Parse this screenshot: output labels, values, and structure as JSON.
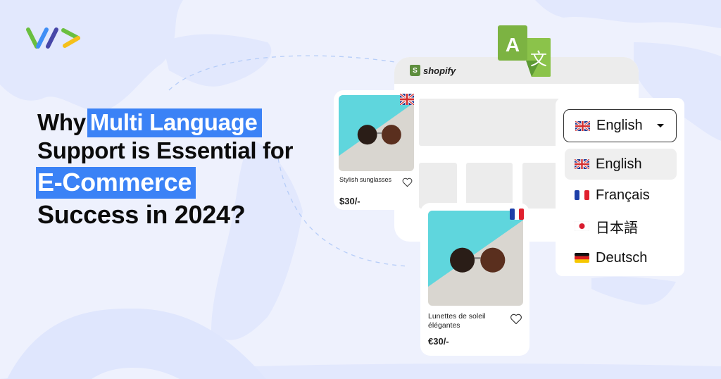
{
  "brand": {
    "logo_icon": "code-chevron-logo"
  },
  "headline": {
    "line1_prefix": "Why",
    "line1_highlight": "Multi Language",
    "line2": "Support is Essential for",
    "line3_highlight": "E-Commerce",
    "line4": "Success in 2024?"
  },
  "colors": {
    "background": "#eef1fd",
    "highlight": "#3b82f6",
    "translate_green": "#7cb342",
    "shopify_green": "#5e8e3e"
  },
  "store_window": {
    "platform_label": "shopify",
    "platform_icon": "shopify-bag-icon",
    "translate_icon": "translate-icon",
    "translate_glyph_a": "A",
    "translate_glyph_b": "文"
  },
  "products": [
    {
      "name": "Stylish sunglasses",
      "price": "$30/-",
      "flag": "uk-flag",
      "locale": "en"
    },
    {
      "name": "Lunettes de soleil élégantes",
      "price": "€30/-",
      "flag": "fr-flag",
      "locale": "fr"
    }
  ],
  "language_selector": {
    "selected": {
      "label": "English",
      "flag": "uk-flag"
    },
    "options": [
      {
        "label": "English",
        "flag": "uk-flag",
        "selected": true
      },
      {
        "label": "Français",
        "flag": "fr-flag",
        "selected": false
      },
      {
        "label": "日本語",
        "flag": "jp-flag",
        "selected": false
      },
      {
        "label": "Deutsch",
        "flag": "de-flag",
        "selected": false
      }
    ]
  }
}
